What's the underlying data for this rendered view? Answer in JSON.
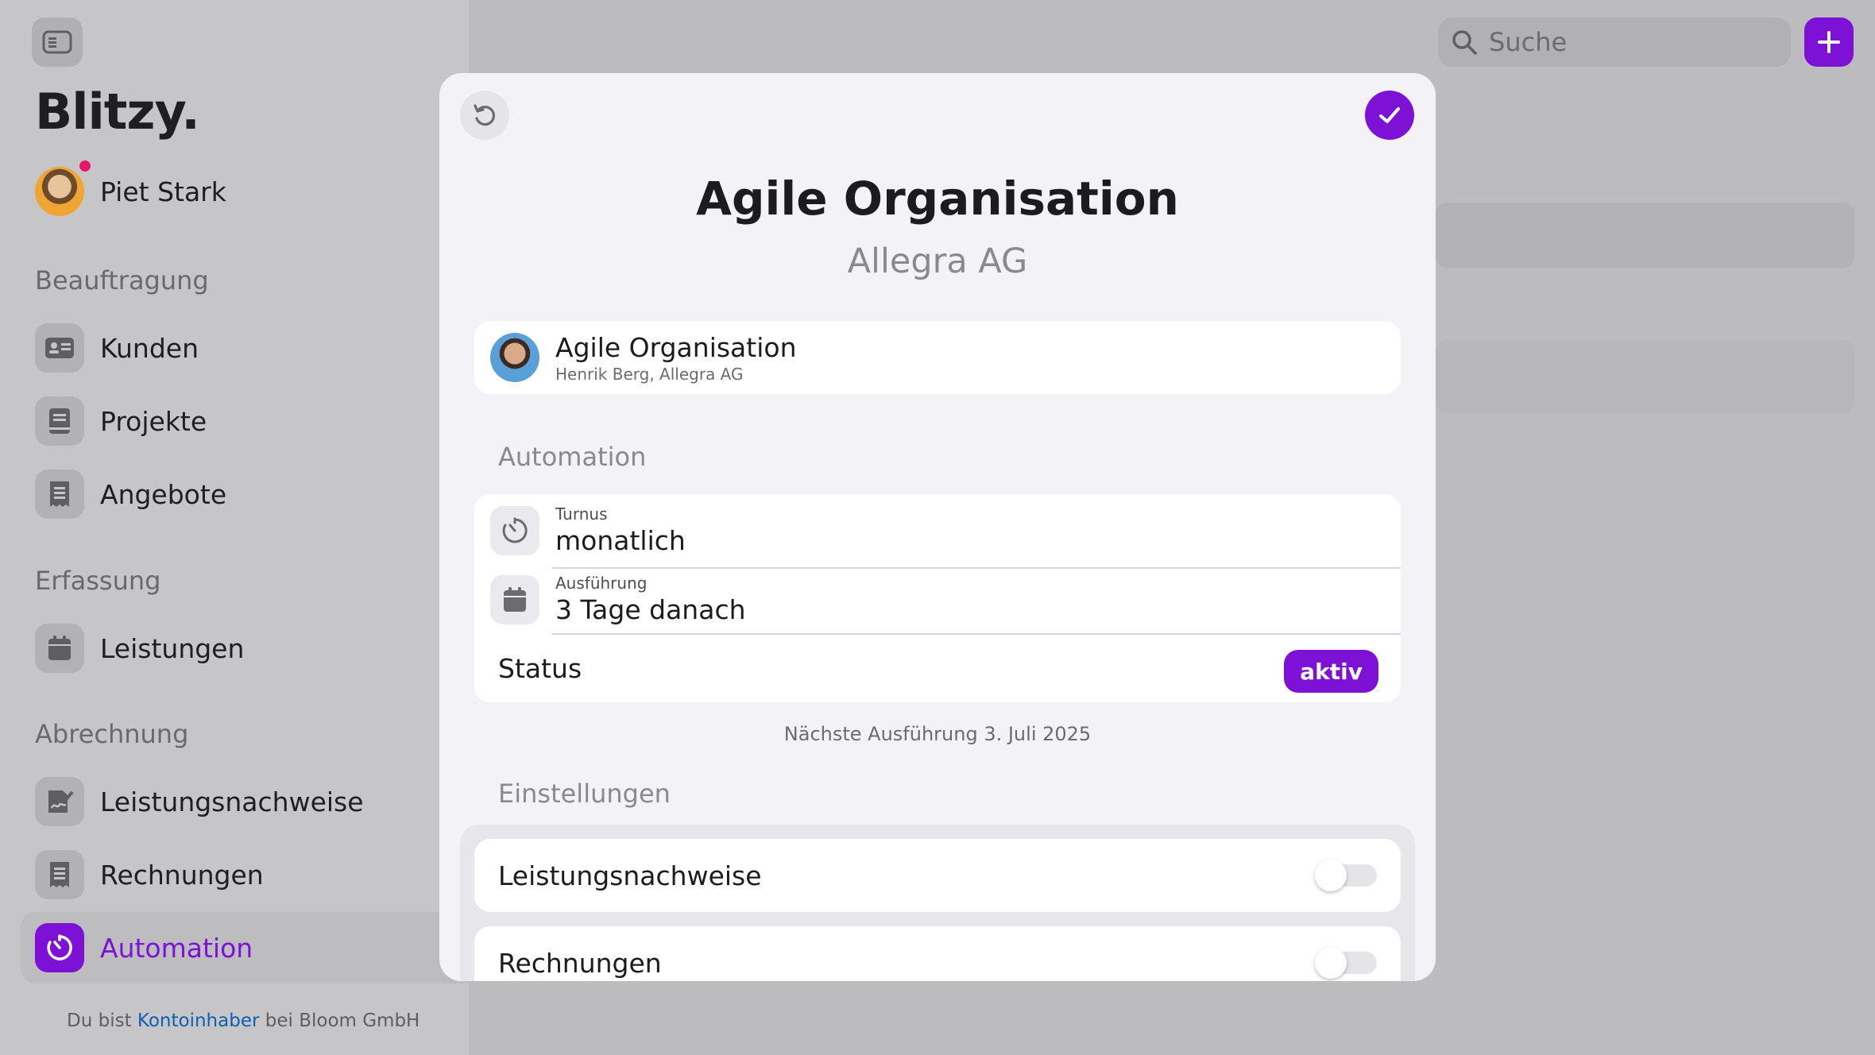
{
  "app": {
    "logo": "Blitzy."
  },
  "user": {
    "name": "Piet Stark"
  },
  "sidebar": {
    "sections": [
      {
        "title": "Beauftragung",
        "items": [
          {
            "label": "Kunden",
            "icon": "contact-card-icon"
          },
          {
            "label": "Projekte",
            "icon": "book-icon"
          },
          {
            "label": "Angebote",
            "icon": "receipt-icon"
          }
        ]
      },
      {
        "title": "Erfassung",
        "items": [
          {
            "label": "Leistungen",
            "icon": "calendar-icon"
          }
        ]
      },
      {
        "title": "Abrechnung",
        "items": [
          {
            "label": "Leistungsnachweise",
            "icon": "signature-icon"
          },
          {
            "label": "Rechnungen",
            "icon": "receipt-icon"
          },
          {
            "label": "Automation",
            "icon": "timer-icon",
            "active": true
          }
        ]
      }
    ],
    "footer": {
      "prefix": "Du bist ",
      "link": "Kontoinhaber",
      "suffix": " bei Bloom GmbH"
    }
  },
  "search": {
    "placeholder": "Suche"
  },
  "colors": {
    "accent": "#7d12d6",
    "link": "#0e5fb4",
    "notification": "#e5186a"
  },
  "modal": {
    "title": "Agile Organisation",
    "subtitle": "Allegra AG",
    "contact": {
      "name": "Agile Organisation",
      "sub": "Henrik Berg, Allegra AG"
    },
    "automation": {
      "section_title": "Automation",
      "turnus": {
        "label": "Turnus",
        "value": "monatlich"
      },
      "ausfuehrung": {
        "label": "Ausführung",
        "value": "3 Tage danach"
      },
      "status": {
        "label": "Status",
        "value": "aktiv"
      }
    },
    "next_run": "Nächste Ausführung 3. Juli 2025",
    "settings": {
      "section_title": "Einstellungen",
      "items": [
        {
          "label": "Leistungsnachweise",
          "enabled": false
        },
        {
          "label": "Rechnungen",
          "enabled": false
        }
      ]
    }
  }
}
